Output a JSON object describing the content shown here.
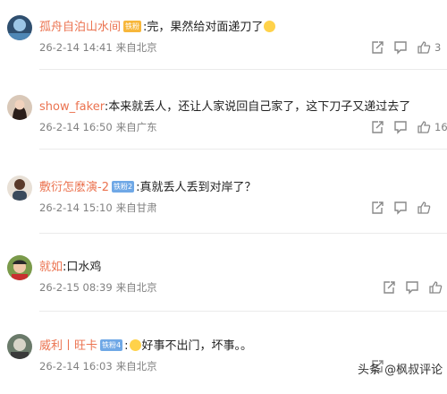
{
  "comments": [
    {
      "username": "孤舟自泊山水间",
      "badge": "铁粉",
      "badge_color": "#f7b73b",
      "separator": ":",
      "text": "完，果然给对面递刀了",
      "emoji": "smile-emoji",
      "date": "26-2-14 14:41",
      "location": "来自北京",
      "likes": "3"
    },
    {
      "username": "show_faker",
      "separator": ":",
      "text": "本来就丢人，还让人家说回自己家了，这下刀子又递过去了",
      "date": "26-2-14 16:50",
      "location": "来自广东",
      "likes": "16"
    },
    {
      "username": "敷衍怎麽演-2",
      "badge": "铁粉2",
      "badge_color": "#6fa8e6",
      "separator": ":",
      "text": "真就丢人丢到对岸了？",
      "date": "26-2-14 15:10",
      "location": "来自甘肃",
      "likes": ""
    },
    {
      "username": "就如",
      "separator": ":",
      "text": "口水鸡",
      "date": "26-2-15 08:39",
      "location": "来自北京",
      "likes": ""
    },
    {
      "username": "威利丨旺卡",
      "badge": "铁粉4",
      "badge_color": "#6fa8e6",
      "separator": ":",
      "text": "好事不出门，坏事。。",
      "emoji": "sweat-emoji",
      "date": "26-2-14 16:03",
      "location": "来自北京",
      "likes": ""
    }
  ],
  "watermark": "头条 @枫叔评论",
  "colors": {
    "username": "#eb7350",
    "meta": "#808080",
    "text": "#222222"
  }
}
